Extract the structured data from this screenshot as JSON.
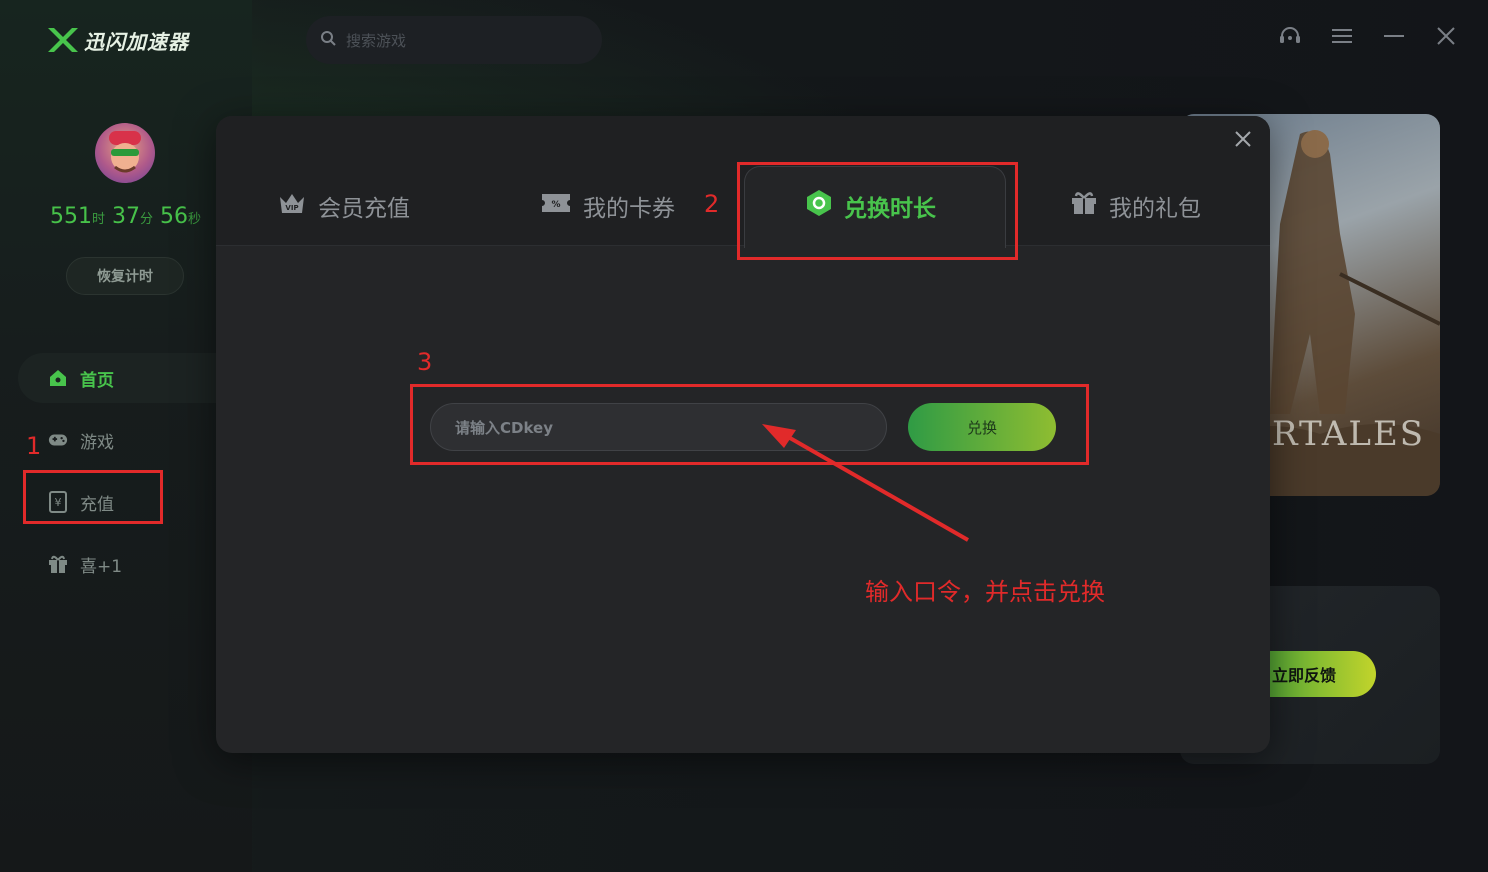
{
  "app": {
    "name": "迅闪加速器"
  },
  "search": {
    "placeholder": "搜索游戏"
  },
  "user": {
    "timer": {
      "hours": "551",
      "hours_unit": "时",
      "minutes": "37",
      "minutes_unit": "分",
      "seconds": "56",
      "seconds_unit": "秒"
    },
    "resume_label": "恢复计时"
  },
  "sidebar": {
    "items": [
      {
        "label": "首页",
        "icon": "home-icon"
      },
      {
        "label": "游戏",
        "icon": "gamepad-icon"
      },
      {
        "label": "充值",
        "icon": "wallet-icon"
      },
      {
        "label": "喜+1",
        "icon": "gift-icon"
      }
    ]
  },
  "background": {
    "hero_text": "RTALES",
    "feedback_label": "立即反馈"
  },
  "modal": {
    "tabs": [
      {
        "label": "会员充值",
        "icon": "vip-crown-icon"
      },
      {
        "label": "我的卡券",
        "icon": "coupon-icon"
      },
      {
        "label": "兑换时长",
        "icon": "redeem-icon"
      },
      {
        "label": "我的礼包",
        "icon": "gift-icon"
      }
    ],
    "active_tab": "兑换时长",
    "cdkey_placeholder": "请输入CDkey",
    "redeem_label": "兑换"
  },
  "annotations": {
    "step1": "1",
    "step2": "2",
    "step3": "3",
    "instruction": "输入口令，并点击兑换"
  },
  "colors": {
    "accent": "#48c44c",
    "annotation": "#e12a2a"
  }
}
